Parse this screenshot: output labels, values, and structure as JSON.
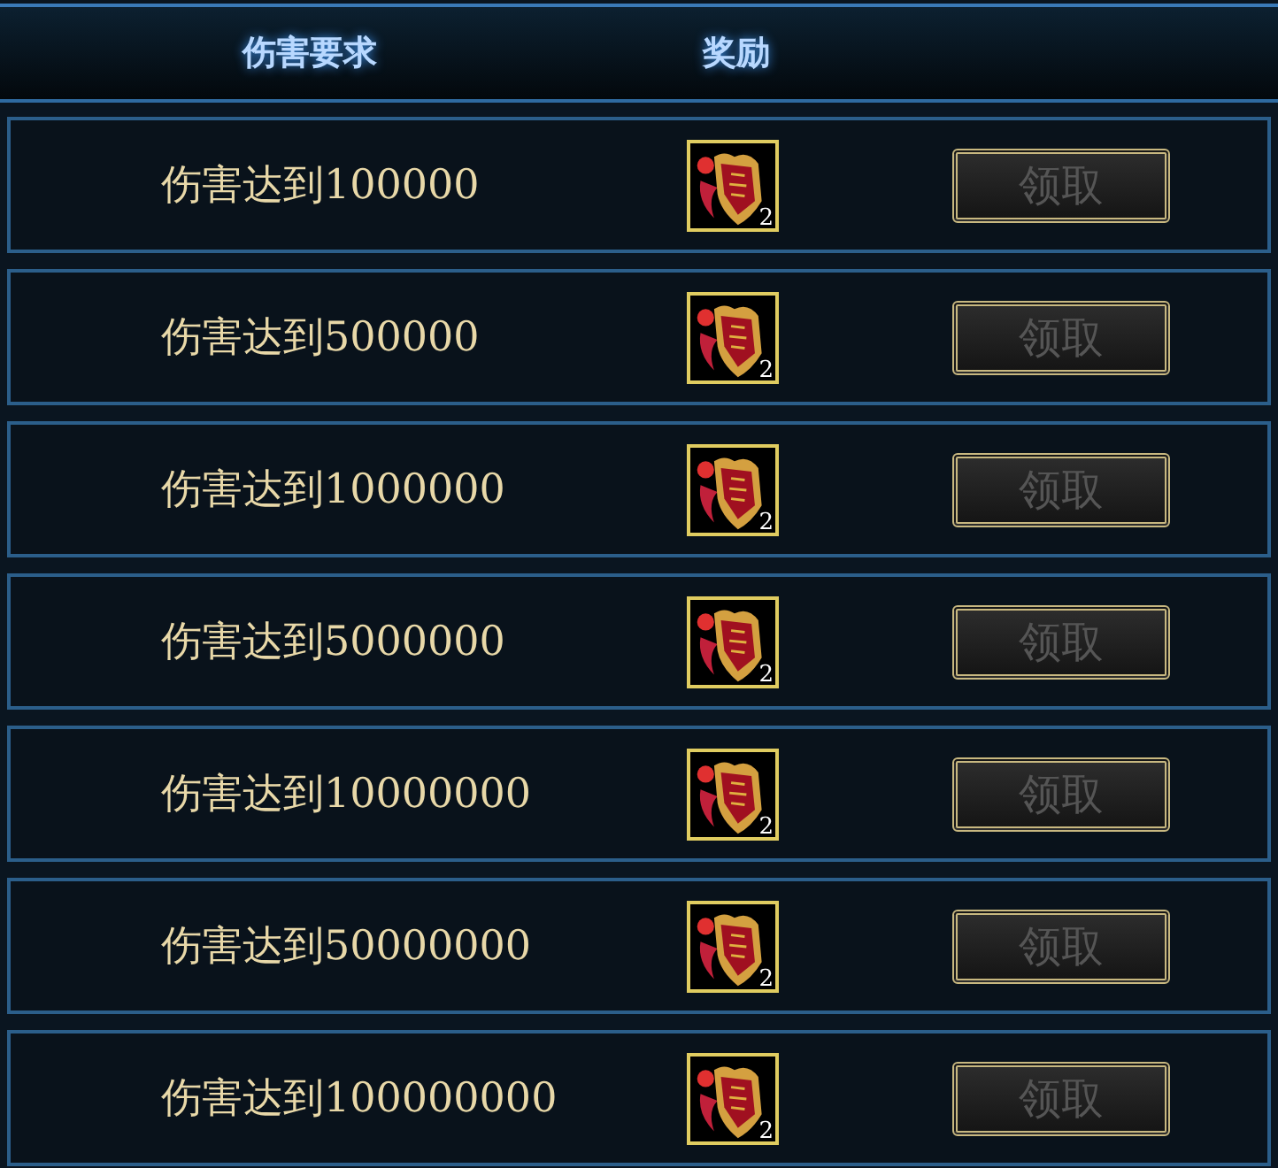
{
  "header": {
    "columns": [
      "伤害要求",
      "奖励"
    ]
  },
  "rows": [
    {
      "requirement": "伤害达到100000",
      "reward_count": "2",
      "button": "领取",
      "disabled": true
    },
    {
      "requirement": "伤害达到500000",
      "reward_count": "2",
      "button": "领取",
      "disabled": true
    },
    {
      "requirement": "伤害达到1000000",
      "reward_count": "2",
      "button": "领取",
      "disabled": true
    },
    {
      "requirement": "伤害达到5000000",
      "reward_count": "2",
      "button": "领取",
      "disabled": true
    },
    {
      "requirement": "伤害达到10000000",
      "reward_count": "2",
      "button": "领取",
      "disabled": true
    },
    {
      "requirement": "伤害达到50000000",
      "reward_count": "2",
      "button": "领取",
      "disabled": true
    },
    {
      "requirement": "伤害达到100000000",
      "reward_count": "2",
      "button": "领取",
      "disabled": true
    }
  ]
}
